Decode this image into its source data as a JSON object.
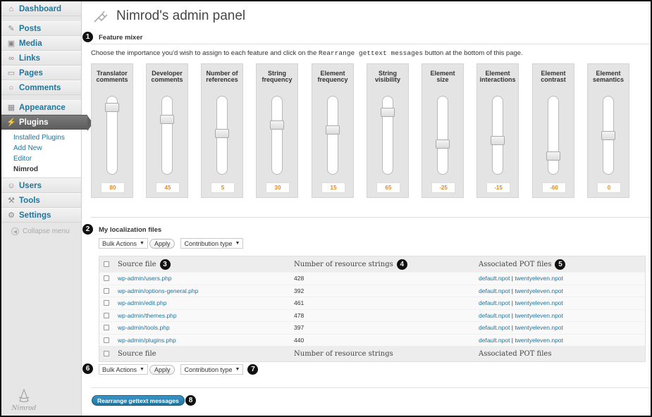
{
  "sidebar": {
    "items": [
      {
        "label": "Dashboard",
        "icon": "house-icon"
      },
      {
        "label": "Posts",
        "icon": "pin-icon"
      },
      {
        "label": "Media",
        "icon": "camera-icon"
      },
      {
        "label": "Links",
        "icon": "link-icon"
      },
      {
        "label": "Pages",
        "icon": "page-icon"
      },
      {
        "label": "Comments",
        "icon": "speech-bubble-icon"
      },
      {
        "label": "Appearance",
        "icon": "appearance-icon"
      },
      {
        "label": "Plugins",
        "icon": "plug-icon"
      },
      {
        "label": "Users",
        "icon": "users-icon"
      },
      {
        "label": "Tools",
        "icon": "wrench-icon"
      },
      {
        "label": "Settings",
        "icon": "settings-icon"
      }
    ],
    "submenu": [
      "Installed Plugins",
      "Add New",
      "Editor",
      "Nimrod"
    ],
    "collapse": "Collapse menu",
    "logo_text": "Nimrod"
  },
  "page": {
    "title": "Nimrod's admin panel"
  },
  "feature_mixer": {
    "heading": "Feature mixer",
    "instruction_pre": "Choose the importance you'd wish to assign to each feature and click on the ",
    "instruction_code": "Rearrange gettext messages",
    "instruction_post": " button at the bottom of this page.",
    "features": [
      {
        "l1": "Translator",
        "l2": "comments",
        "value": "80"
      },
      {
        "l1": "Developer",
        "l2": "comments",
        "value": "45"
      },
      {
        "l1": "Number of",
        "l2": "references",
        "value": "5"
      },
      {
        "l1": "String",
        "l2": "frequency",
        "value": "30"
      },
      {
        "l1": "Element",
        "l2": "frequency",
        "value": "15"
      },
      {
        "l1": "String",
        "l2": "visibility",
        "value": "65"
      },
      {
        "l1": "Element",
        "l2": "size",
        "value": "-25"
      },
      {
        "l1": "Element",
        "l2": "interactions",
        "value": "-15"
      },
      {
        "l1": "Element",
        "l2": "contrast",
        "value": "-60"
      },
      {
        "l1": "Element",
        "l2": "semantics",
        "value": "0"
      }
    ]
  },
  "files": {
    "heading": "My localization files",
    "bulk_actions": "Bulk Actions",
    "apply": "Apply",
    "contribution_type": "Contribution type",
    "columns": [
      "Source file",
      "Number of resource strings",
      "Associated POT files"
    ],
    "rows": [
      {
        "file": "wp-admin/users.php",
        "count": "428",
        "pot1": "default.npot",
        "pot2": "twentyeleven.npot"
      },
      {
        "file": "wp-admin/options-general.php",
        "count": "392",
        "pot1": "default.npot",
        "pot2": "twentyeleven.npot"
      },
      {
        "file": "wp-admin/edit.php",
        "count": "461",
        "pot1": "default.npot",
        "pot2": "twentyeleven.npot"
      },
      {
        "file": "wp-admin/themes.php",
        "count": "478",
        "pot1": "default.npot",
        "pot2": "twentyeleven.npot"
      },
      {
        "file": "wp-admin/tools.php",
        "count": "397",
        "pot1": "default.npot",
        "pot2": "twentyeleven.npot"
      },
      {
        "file": "wp-admin/plugins.php",
        "count": "440",
        "pot1": "default.npot",
        "pot2": "twentyeleven.npot"
      }
    ],
    "pot_separator": " | "
  },
  "primary_button": "Rearrange gettext messages",
  "callouts": [
    "1",
    "2",
    "3",
    "4",
    "5",
    "6",
    "7",
    "8"
  ]
}
